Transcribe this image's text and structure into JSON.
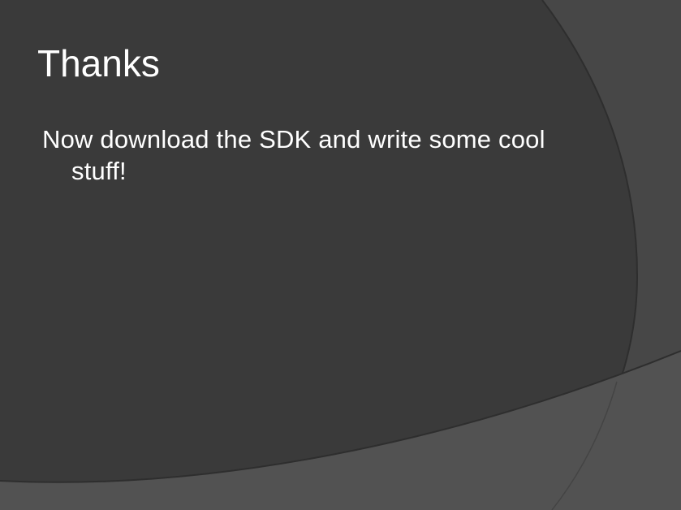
{
  "slide": {
    "title": "Thanks",
    "body": "Now download the SDK and write some cool stuff!"
  },
  "colors": {
    "background_main": "#3a3a3a",
    "background_outer": "#474747",
    "background_lower": "#525252",
    "arc_stroke": "#2c2c2c",
    "text": "#ffffff"
  }
}
